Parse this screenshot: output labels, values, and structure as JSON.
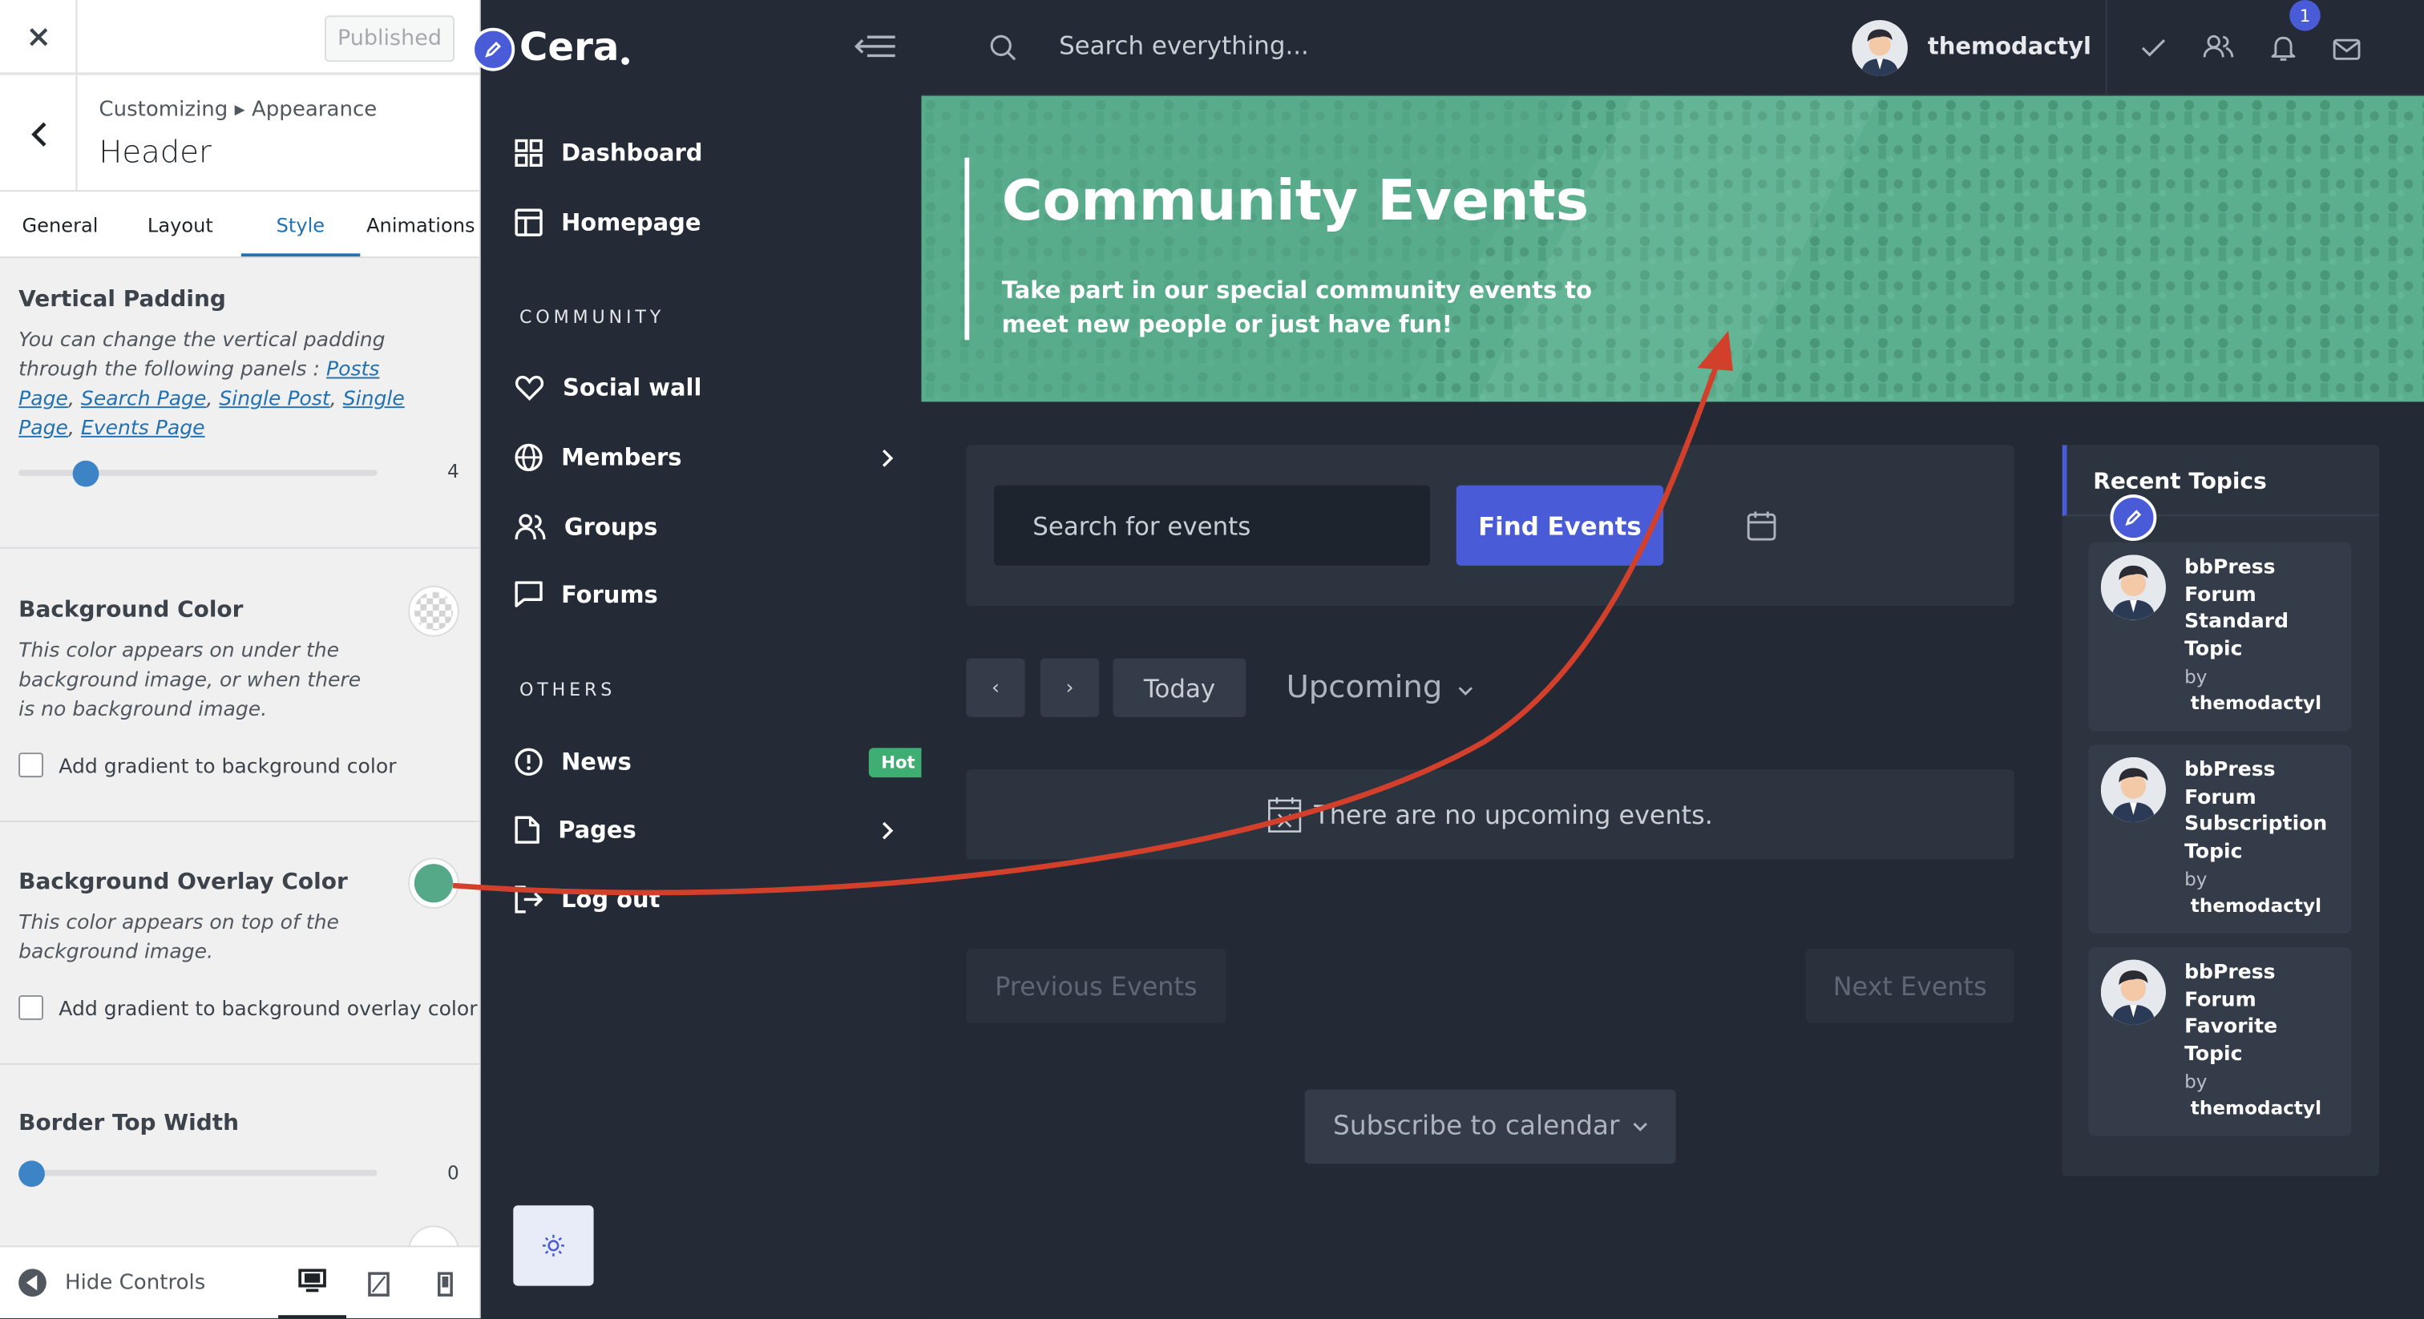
{
  "customizer": {
    "published_label": "Published",
    "breadcrumb": "Customizing ▸ Appearance",
    "title": "Header",
    "tabs": [
      "General",
      "Layout",
      "Style",
      "Animations"
    ],
    "active_tab": "Style",
    "vertical_padding": {
      "label": "Vertical Padding",
      "description_prefix": "You can change the vertical padding through the following panels :",
      "links": [
        "Posts Page",
        "Search Page",
        "Single Post",
        "Single Page",
        "Events Page"
      ],
      "value": "4"
    },
    "background_color": {
      "label": "Background Color",
      "description": "This color appears on under the background image, or when there is no background image.",
      "checkbox_label": "Add gradient to background color"
    },
    "overlay_color": {
      "label": "Background Overlay Color",
      "description": "This color appears on top of the background image.",
      "checkbox_label": "Add gradient to background overlay color",
      "swatch": "#56a988"
    },
    "border_top": {
      "label": "Border Top Width",
      "value": "0"
    },
    "footer": {
      "hide_controls": "Hide Controls"
    }
  },
  "brand": {
    "name": "Cera",
    "accent": "#4a5bd8"
  },
  "nav": {
    "items_top": [
      "Dashboard",
      "Homepage"
    ],
    "section_community": "COMMUNITY",
    "items_community": [
      "Social wall",
      "Members",
      "Groups",
      "Forums"
    ],
    "section_others": "OTHERS",
    "items_others": [
      "News",
      "Pages",
      "Log out"
    ],
    "news_badge": "Hot"
  },
  "topbar": {
    "search_placeholder": "Search everything...",
    "username": "themodactyl",
    "notification_count": "1"
  },
  "hero": {
    "title": "Community Events",
    "subtitle": "Take part in our special community events to meet new people or just have fun!",
    "overlay_color": "#56a988"
  },
  "events": {
    "search_placeholder": "Search for events",
    "find_button": "Find Events",
    "prev_arrow": "‹",
    "next_arrow": "›",
    "today": "Today",
    "view": "Upcoming",
    "empty_message": "There are no upcoming events.",
    "previous_events": "Previous Events",
    "next_events": "Next Events",
    "subscribe": "Subscribe to calendar"
  },
  "recent_topics": {
    "title": "Recent Topics",
    "by_label": "by",
    "topics": [
      {
        "title": "bbPress Forum Standard Topic",
        "author": "themodactyl"
      },
      {
        "title": "bbPress Forum Subscription Topic",
        "author": "themodactyl"
      },
      {
        "title": "bbPress Forum Favorite Topic",
        "author": "themodactyl"
      }
    ]
  },
  "annotation_arrow_color": "#d2402c"
}
